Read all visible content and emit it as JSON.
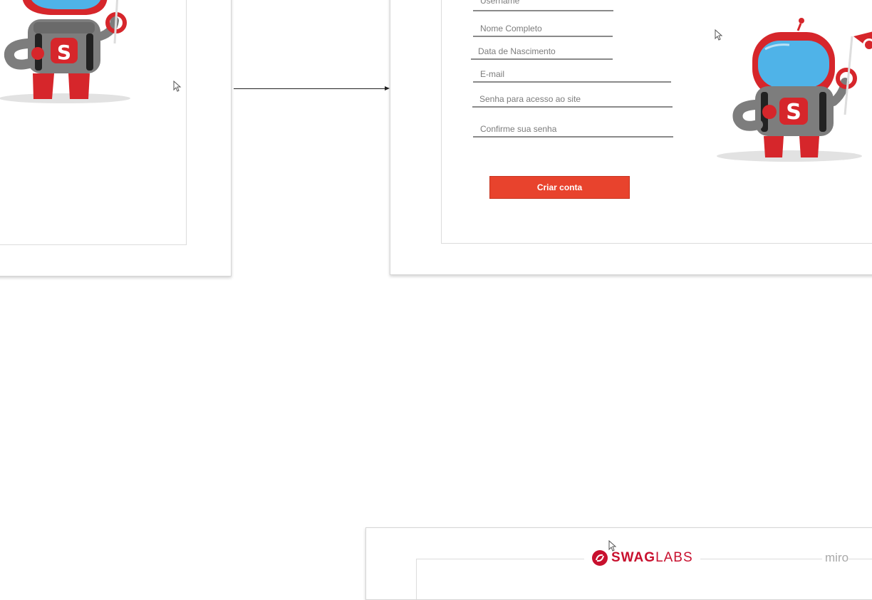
{
  "signup_form": {
    "fields": [
      {
        "placeholder": "Username"
      },
      {
        "placeholder": "Nome Completo"
      },
      {
        "placeholder": "Data de Nascimento"
      },
      {
        "placeholder": "E-mail"
      },
      {
        "placeholder": "Senha para acesso ao site"
      },
      {
        "placeholder": "Confirme sua senha"
      }
    ],
    "submit_label": "Criar conta"
  },
  "bottom_frame": {
    "logo_swag": "SWAG",
    "logo_labs": "LABS",
    "watermark": "miro"
  },
  "colors": {
    "accent": "#e8432d",
    "robot_red": "#d6262b",
    "robot_gray": "#7d7d7d",
    "visor_blue": "#4fb3e8"
  },
  "icons": [
    "robot-mascot",
    "swaglabs-logo-icon",
    "cursor-icon",
    "arrow-connector"
  ]
}
